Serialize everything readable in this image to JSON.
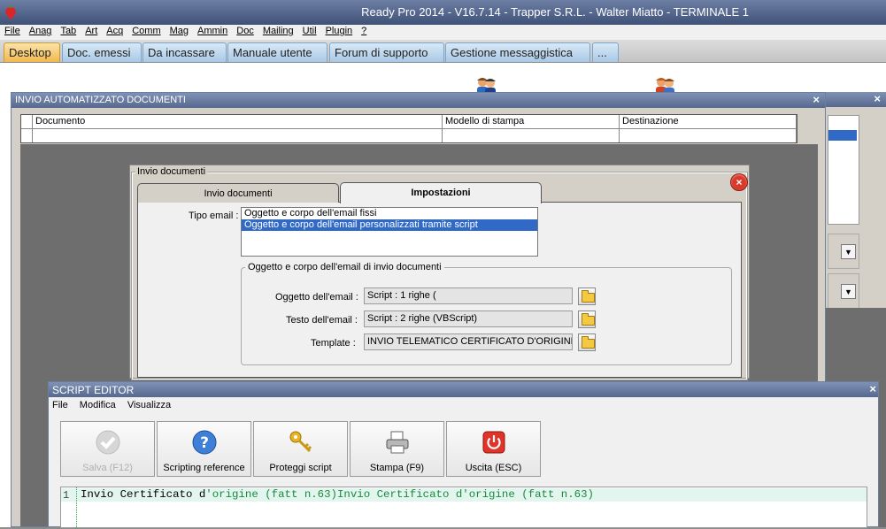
{
  "window": {
    "title": "Ready Pro 2014 - V16.7.14 - Trapper S.R.L. - Walter Miatto - TERMINALE 1"
  },
  "menu": [
    "File",
    "Anag",
    "Tab",
    "Art",
    "Acq",
    "Comm",
    "Mag",
    "Ammin",
    "Doc",
    "Mailing",
    "Util",
    "Plugin",
    "?"
  ],
  "tabs": [
    "Desktop",
    "Doc. emessi",
    "Da incassare",
    "Manuale utente",
    "Forum di supporto",
    "Gestione messaggistica",
    "..."
  ],
  "auto_window": {
    "title": "INVIO AUTOMATIZZATO DOCUMENTI",
    "columns": [
      "Documento",
      "Modello di stampa",
      "Destinazione"
    ]
  },
  "invio_dialog": {
    "group_title": "Invio documenti",
    "tabs": [
      "Invio documenti",
      "Impostazioni"
    ],
    "active_tab": "Impostazioni",
    "tipo_email_label": "Tipo email :",
    "tipo_email_options": [
      "Oggetto e corpo dell'email fissi",
      "Oggetto e corpo dell'email personalizzati tramite script"
    ],
    "tipo_email_selected": "Oggetto e corpo dell'email personalizzati tramite script",
    "group2_title": "Oggetto e corpo dell'email di invio documenti",
    "oggetto_label": "Oggetto dell'email :",
    "oggetto_value": "Script : 1 righe (",
    "testo_label": "Testo dell'email :",
    "testo_value": "Script : 2 righe (VBScript)",
    "template_label": "Template :",
    "template_value": "INVIO TELEMATICO CERTIFICATO D'ORIGINE"
  },
  "script_editor": {
    "title": "SCRIPT EDITOR",
    "menu": [
      "File",
      "Modifica",
      "Visualizza"
    ],
    "buttons": {
      "save": "Salva (F12)",
      "reference": "Scripting reference",
      "protect": "Proteggi script",
      "print": "Stampa (F9)",
      "exit": "Uscita (ESC)"
    },
    "line_number": "1",
    "code": {
      "part1": "Invio Certificato d",
      "part2": "'origine (fatt n.63)",
      "part3": "Invio Certificato d'origine (fatt n.63)"
    }
  },
  "close_glyph": "×"
}
